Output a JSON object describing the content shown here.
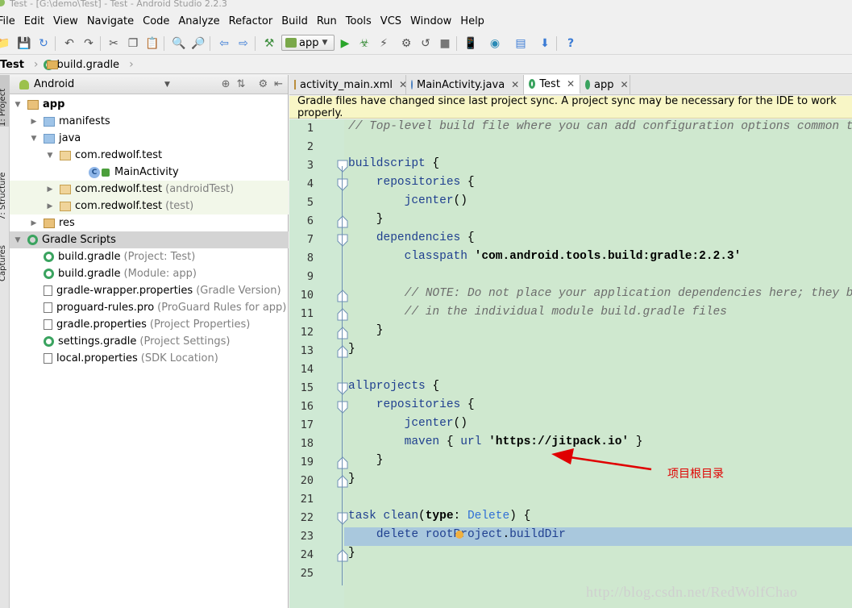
{
  "window": {
    "title": "Test - [G:\\demo\\Test] - Test - Android Studio 2.2.3"
  },
  "menu": [
    "File",
    "Edit",
    "View",
    "Navigate",
    "Code",
    "Analyze",
    "Refactor",
    "Build",
    "Run",
    "Tools",
    "VCS",
    "Window",
    "Help"
  ],
  "toolbar": {
    "run_config": "app"
  },
  "breadcrumb": {
    "project": "Test",
    "file": "build.gradle"
  },
  "side_tabs": {
    "project": "1: Project",
    "structure": "7: Structure",
    "captures": "Captures"
  },
  "project_panel": {
    "view_selector": "Android",
    "tree": [
      {
        "label": "app",
        "sub": "",
        "icon": "app-folder-icon",
        "bold": true
      },
      {
        "label": "manifests",
        "sub": "",
        "icon": "folder-icon"
      },
      {
        "label": "java",
        "sub": "",
        "icon": "folder-icon"
      },
      {
        "label": "com.redwolf.test",
        "sub": "",
        "icon": "package-icon"
      },
      {
        "label": "MainActivity",
        "sub": "",
        "icon": "class-icon"
      },
      {
        "label": "com.redwolf.test",
        "sub": "(androidTest)",
        "icon": "package-icon"
      },
      {
        "label": "com.redwolf.test",
        "sub": "(test)",
        "icon": "package-icon"
      },
      {
        "label": "res",
        "sub": "",
        "icon": "res-folder-icon"
      },
      {
        "label": "Gradle Scripts",
        "sub": "",
        "icon": "gradle-icon"
      },
      {
        "label": "build.gradle",
        "sub": "(Project: Test)",
        "icon": "gradle-icon"
      },
      {
        "label": "build.gradle",
        "sub": "(Module: app)",
        "icon": "gradle-icon"
      },
      {
        "label": "gradle-wrapper.properties",
        "sub": "(Gradle Version)",
        "icon": "properties-icon"
      },
      {
        "label": "proguard-rules.pro",
        "sub": "(ProGuard Rules for app)",
        "icon": "properties-icon"
      },
      {
        "label": "gradle.properties",
        "sub": "(Project Properties)",
        "icon": "properties-icon"
      },
      {
        "label": "settings.gradle",
        "sub": "(Project Settings)",
        "icon": "gradle-icon"
      },
      {
        "label": "local.properties",
        "sub": "(SDK Location)",
        "icon": "properties-icon"
      }
    ]
  },
  "editor": {
    "tabs": [
      {
        "label": "activity_main.xml",
        "icon": "xml-file-icon"
      },
      {
        "label": "MainActivity.java",
        "icon": "java-class-icon"
      },
      {
        "label": "Test",
        "icon": "gradle-icon",
        "active": true
      },
      {
        "label": "app",
        "icon": "gradle-icon"
      }
    ],
    "banner": "Gradle files have changed since last project sync. A project sync may be necessary for the IDE to work properly.",
    "current_line": 23,
    "lines": [
      "// Top-level build file where you can add configuration options common to all",
      "",
      "buildscript {",
      "    repositories {",
      "        jcenter()",
      "    }",
      "    dependencies {",
      "        classpath 'com.android.tools.build:gradle:2.2.3'",
      "",
      "        // NOTE: Do not place your application dependencies here; they belong",
      "        // in the individual module build.gradle files",
      "    }",
      "}",
      "",
      "allprojects {",
      "    repositories {",
      "        jcenter()",
      "        maven { url 'https://jitpack.io' }",
      "    }",
      "}",
      "",
      "task clean(type: Delete) {",
      "    delete rootProject.buildDir",
      "}",
      ""
    ]
  },
  "annotation": {
    "text": "项目根目录",
    "color": "#e00000"
  },
  "watermark": "http://blog.csdn.net/RedWolfChao",
  "colors": {
    "editor_bg": "#cfe8cf",
    "current_line": "#a9c8dd",
    "banner": "#f8f6c6"
  }
}
